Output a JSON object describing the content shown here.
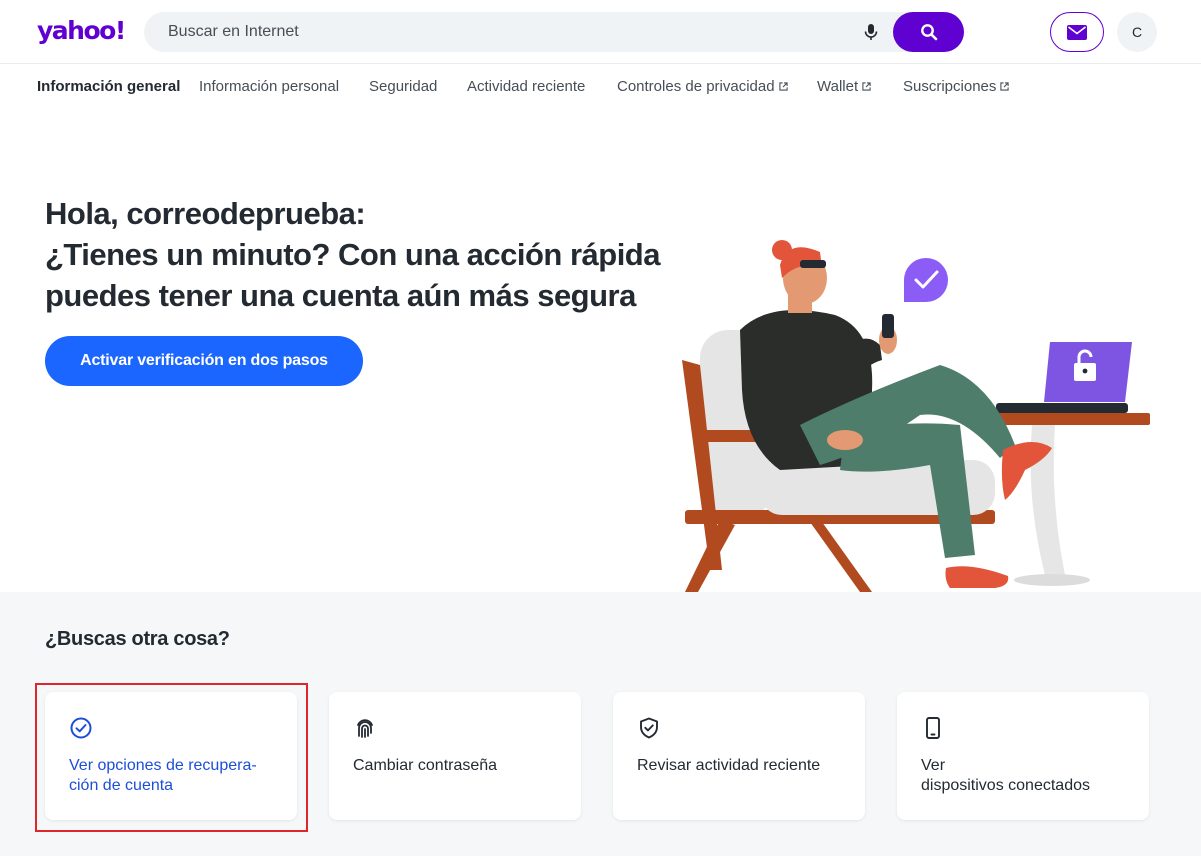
{
  "header": {
    "logo": "yahoo!",
    "search_placeholder": "Buscar en Internet",
    "avatar_initial": "C"
  },
  "nav": {
    "items": [
      {
        "label": "Información general",
        "active": true,
        "external": false
      },
      {
        "label": "Información personal",
        "active": false,
        "external": false
      },
      {
        "label": "Seguridad",
        "active": false,
        "external": false
      },
      {
        "label": "Actividad reciente",
        "active": false,
        "external": false
      },
      {
        "label": "Controles de privacidad",
        "active": false,
        "external": true
      },
      {
        "label": "Wallet",
        "active": false,
        "external": true
      },
      {
        "label": "Suscripciones",
        "active": false,
        "external": true
      }
    ]
  },
  "hero": {
    "title_lines": [
      "Hola, correodeprueba:",
      "¿Tienes un minuto? Con una acción rápida",
      "puedes tener una cuenta aún más segura"
    ],
    "cta_label": "Activar verificación en dos pasos"
  },
  "lower": {
    "title": "¿Buscas otra cosa?",
    "cards": [
      {
        "label": "Ver opciones de recupera-\nción de cuenta",
        "icon": "check-circle-icon",
        "selected": true
      },
      {
        "label": "Cambiar contraseña",
        "icon": "fingerprint-icon",
        "selected": false
      },
      {
        "label": "Revisar actividad reciente",
        "icon": "shield-check-icon",
        "selected": false
      },
      {
        "label": "Ver\ndispositivos conectados",
        "icon": "smartphone-icon",
        "selected": false
      }
    ]
  },
  "colors": {
    "brand_purple": "#6001d2",
    "cta_blue": "#1a66ff",
    "selected_blue": "#1d4ed8",
    "highlight_red": "#e0262d"
  }
}
